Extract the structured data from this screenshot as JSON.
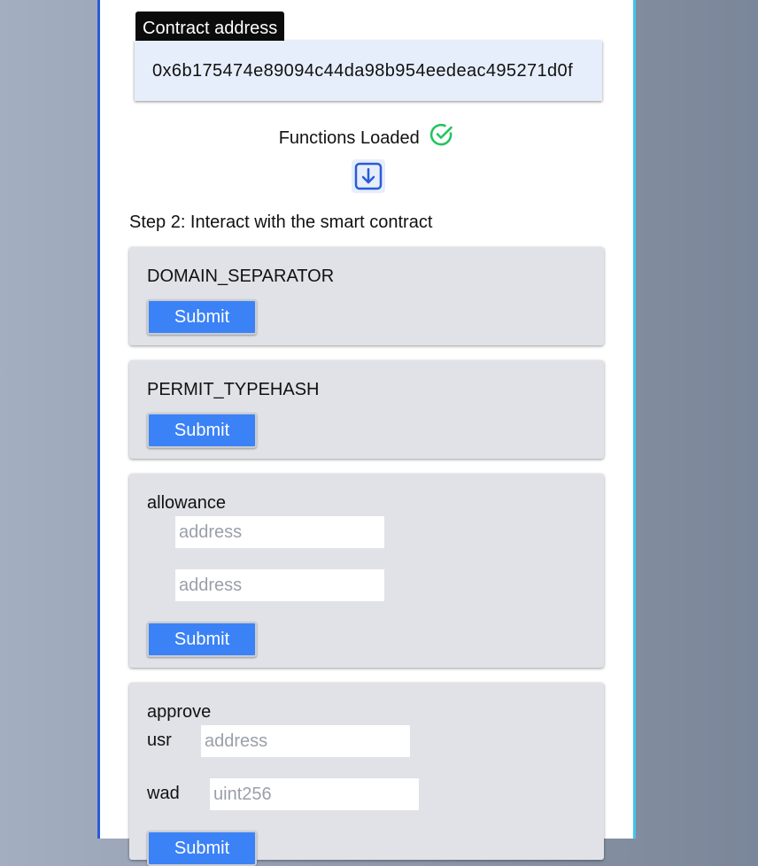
{
  "contract": {
    "label": "Contract address",
    "value": "0x6b175474e89094c44da98b954eedeac495271d0f"
  },
  "status": {
    "text": "Functions Loaded",
    "icon": "check-circle-icon",
    "color": "#22c55e"
  },
  "step2": {
    "title": "Step 2: Interact with the smart contract"
  },
  "functions": [
    {
      "name": "DOMAIN_SEPARATOR",
      "submit": "Submit"
    },
    {
      "name": "PERMIT_TYPEHASH",
      "submit": "Submit"
    },
    {
      "name": "allowance",
      "submit": "Submit",
      "params": [
        {
          "label": "",
          "placeholder": "address"
        },
        {
          "label": "",
          "placeholder": "address"
        }
      ]
    },
    {
      "name": "approve",
      "submit": "Submit",
      "params": [
        {
          "label": "usr",
          "placeholder": "address"
        },
        {
          "label": "wad",
          "placeholder": "uint256"
        }
      ]
    }
  ],
  "colors": {
    "accent": "#3b82f6",
    "panel_border_left": "#2a5bd7",
    "panel_border_right": "#3ec6f0",
    "card_bg": "#e1e2e7"
  }
}
